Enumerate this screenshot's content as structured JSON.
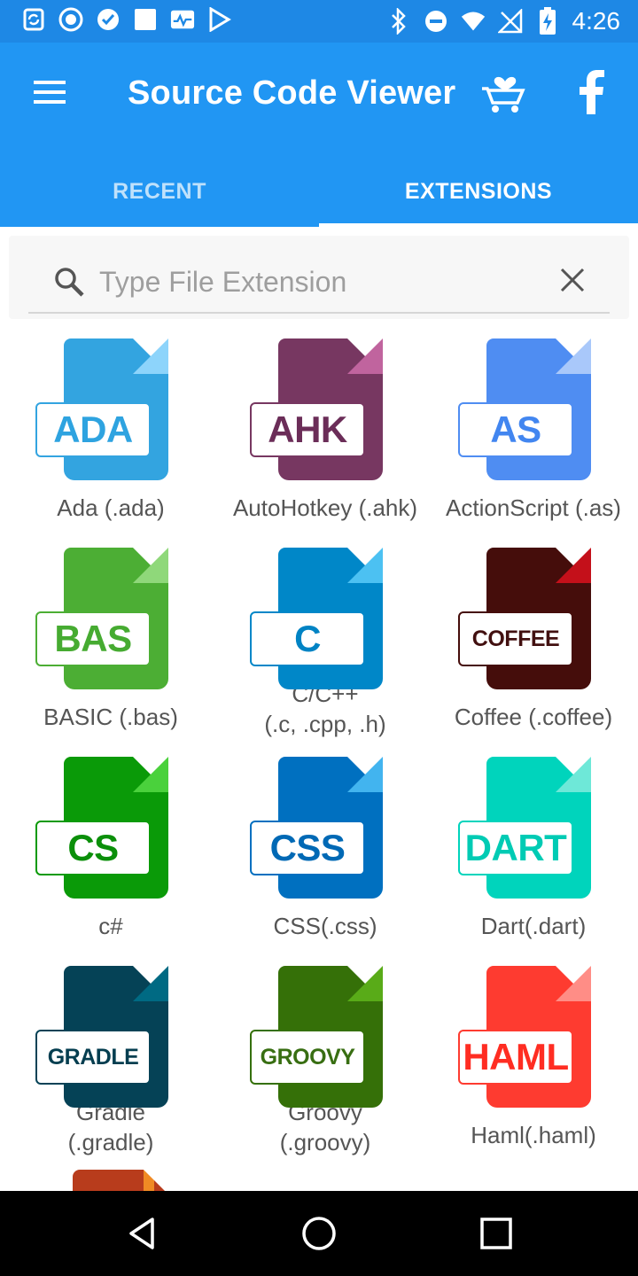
{
  "status_bar": {
    "time": "4:26",
    "icons": [
      "sync-icon",
      "record-icon",
      "checklist-icon",
      "square-icon",
      "activity-icon",
      "play-store-icon",
      "bluetooth-icon",
      "dnd-icon",
      "wifi-icon",
      "no-signal-icon",
      "battery-charging-icon"
    ]
  },
  "app_bar": {
    "title": "Source Code Viewer",
    "menu_icon": "hamburger-menu-icon",
    "cart_icon": "cart-heart-icon",
    "facebook_icon": "facebook-icon",
    "background": "#2196f3"
  },
  "tabs": [
    {
      "label": "RECENT",
      "active": false
    },
    {
      "label": "EXTENSIONS",
      "active": true
    }
  ],
  "search": {
    "placeholder": "Type File Extension",
    "value": ""
  },
  "extensions": [
    {
      "badge": "ADA",
      "name": "Ada (.ada)",
      "body": "#33a4e0",
      "fold": "#8dd4fb",
      "text": "#2ea3e0"
    },
    {
      "badge": "AHK",
      "name": "AutoHotkey (.ahk)",
      "body": "#773761",
      "fold": "#c0649e",
      "text": "#6b2d58"
    },
    {
      "badge": "AS",
      "name": "ActionScript (.as)",
      "body": "#4f8df2",
      "fold": "#a9c8fa",
      "text": "#4286f0"
    },
    {
      "badge": "BAS",
      "name": "BASIC (.bas)",
      "body": "#4cae34",
      "fold": "#8fd87a",
      "text": "#46ab31"
    },
    {
      "badge": "C",
      "name": "C/C++\n(.c, .cpp, .h)",
      "body": "#0087c8",
      "fold": "#4cc1f2",
      "text": "#0083c4"
    },
    {
      "badge": "COFFEE",
      "name": "Coffee (.coffee)",
      "body": "#450d0b",
      "fold": "#c4101a",
      "text": "#421010"
    },
    {
      "badge": "CS",
      "name": "c#",
      "body": "#0a9a08",
      "fold": "#4ad13c",
      "text": "#0b8f0a"
    },
    {
      "badge": "CSS",
      "name": "CSS(.css)",
      "body": "#0070c0",
      "fold": "#42b4ef",
      "text": "#0069b5"
    },
    {
      "badge": "DART",
      "name": "Dart(.dart)",
      "body": "#00d4bc",
      "fold": "#6ee8d8",
      "text": "#00cbb4"
    },
    {
      "badge": "GRADLE",
      "name": "Gradle\n(.gradle)",
      "body": "#054256",
      "fold": "#006a83",
      "text": "#053e50"
    },
    {
      "badge": "GROOVY",
      "name": "Groovy\n(.groovy)",
      "body": "#357008",
      "fold": "#59ab18",
      "text": "#386e12"
    },
    {
      "badge": "HAML",
      "name": "Haml(.haml)",
      "body": "#fe3b30",
      "fold": "#ff8d86",
      "text": "#ff2d22"
    }
  ],
  "nav_bar": {
    "back_icon": "back-triangle-icon",
    "home_icon": "home-circle-icon",
    "recents_icon": "recents-square-icon"
  }
}
